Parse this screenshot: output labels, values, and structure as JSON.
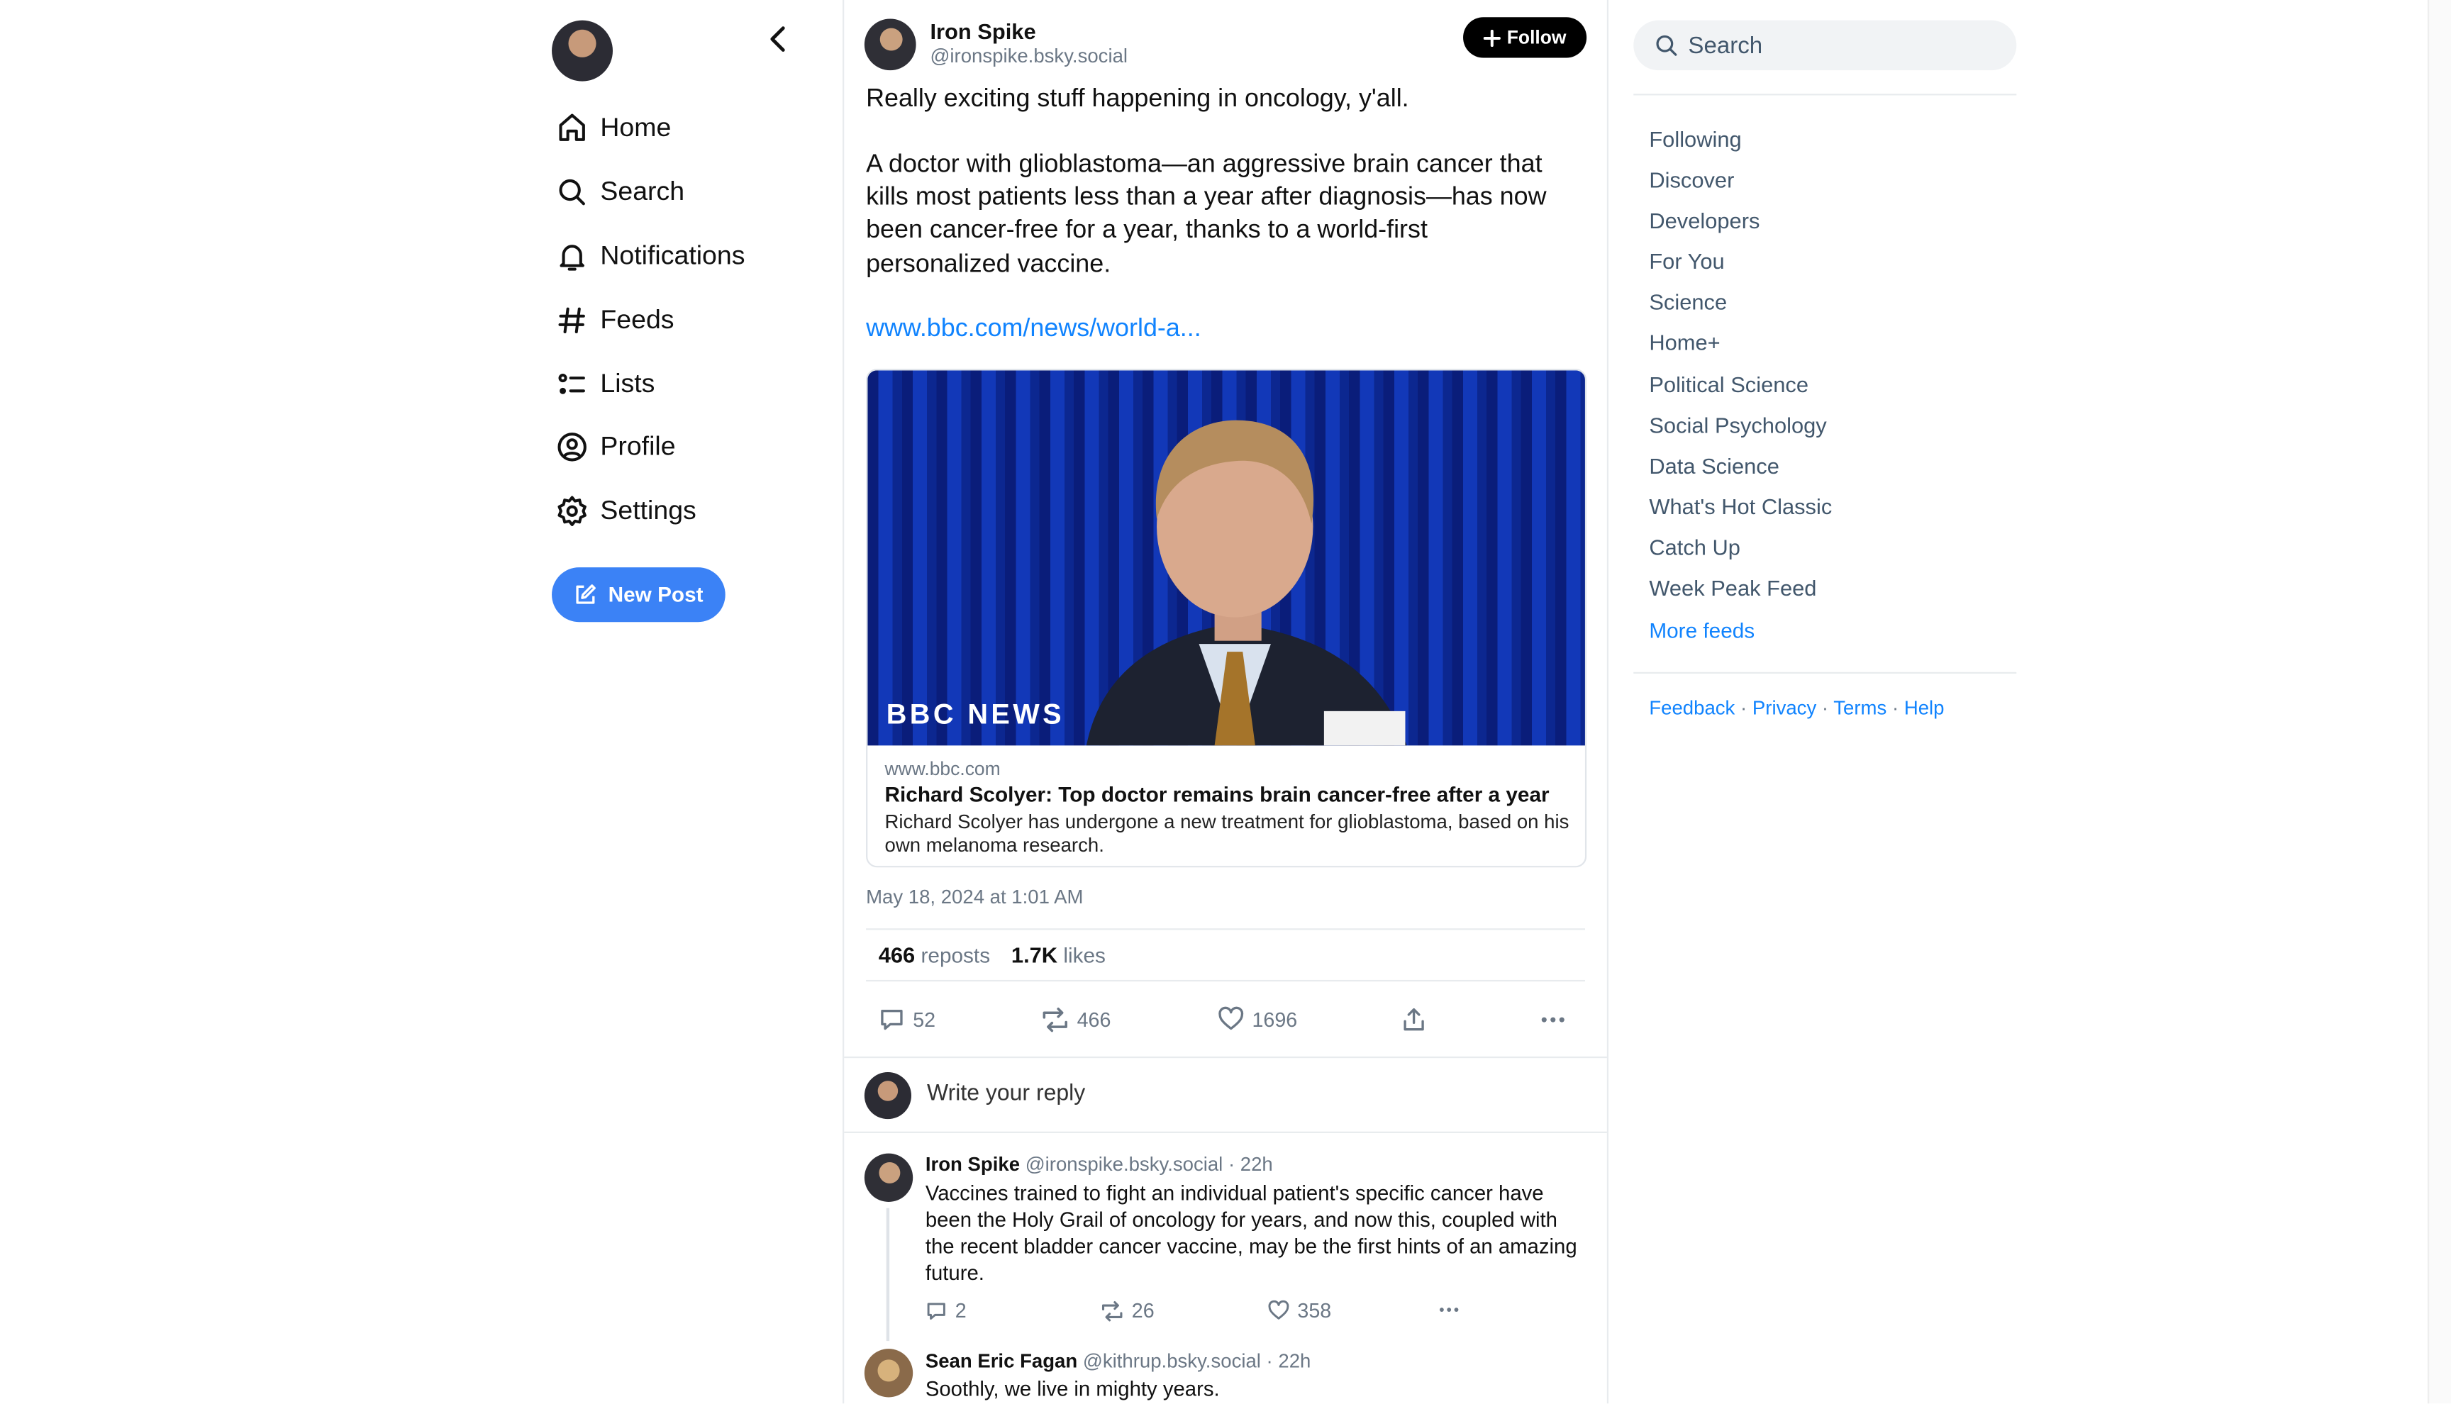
{
  "sidebar": {
    "nav": [
      {
        "label": "Home",
        "icon": "home-icon"
      },
      {
        "label": "Search",
        "icon": "search-icon"
      },
      {
        "label": "Notifications",
        "icon": "bell-icon"
      },
      {
        "label": "Feeds",
        "icon": "hash-icon"
      },
      {
        "label": "Lists",
        "icon": "list-icon"
      },
      {
        "label": "Profile",
        "icon": "user-circle-icon"
      },
      {
        "label": "Settings",
        "icon": "gear-icon"
      }
    ],
    "new_post_label": "New Post"
  },
  "post": {
    "author_name": "Iron Spike",
    "author_handle": "@ironspike.bsky.social",
    "follow_label": "Follow",
    "text_1": "Really exciting stuff happening in oncology, y'all.",
    "text_2": "A doctor with glioblastoma—an aggressive brain cancer that kills most patients less than a year after diagnosis—has now been cancer-free for a year, thanks to a world-first personalized vaccine.",
    "link_text": "www.bbc.com/news/world-a...",
    "card": {
      "image_watermark": "BBC NEWS",
      "domain": "www.bbc.com",
      "title": "Richard Scolyer: Top doctor remains brain cancer-free after a year",
      "description": "Richard Scolyer has undergone a new treatment for glioblastoma, based on his own melanoma research."
    },
    "timestamp": "May 18, 2024 at 1:01 AM",
    "stats": {
      "reposts_count": "466",
      "reposts_label": "reposts",
      "likes_count": "1.7K",
      "likes_label": "likes"
    },
    "actions": {
      "replies": "52",
      "reposts": "466",
      "likes": "1696"
    }
  },
  "reply_box": {
    "placeholder": "Write your reply"
  },
  "replies": [
    {
      "author_name": "Iron Spike",
      "meta": "@ironspike.bsky.social · 22h",
      "text": "Vaccines trained to fight an individual patient's specific cancer have been the Holy Grail of oncology for years, and now this, coupled with the recent bladder cancer vaccine, may be the first hints of an amazing future.",
      "replies": "2",
      "reposts": "26",
      "likes": "358"
    },
    {
      "author_name": "Sean Eric Fagan",
      "meta": "@kithrup.bsky.social · 22h",
      "text": "Soothly, we live in mighty years."
    }
  ],
  "right": {
    "search_placeholder": "Search",
    "feeds": [
      "Following",
      "Discover",
      "Developers",
      "For You",
      "Science",
      "Home+",
      "Political Science",
      "Social Psychology",
      "Data Science",
      "What's Hot Classic",
      "Catch Up",
      "Week Peak Feed"
    ],
    "more_feeds": "More feeds",
    "footer": {
      "feedback": "Feedback",
      "privacy": "Privacy",
      "terms": "Terms",
      "help": "Help",
      "dot": "·"
    }
  },
  "colors": {
    "accent": "#1083fe",
    "button_blue": "#3b82f6",
    "muted": "#6b7785",
    "border": "#e8ebee"
  }
}
